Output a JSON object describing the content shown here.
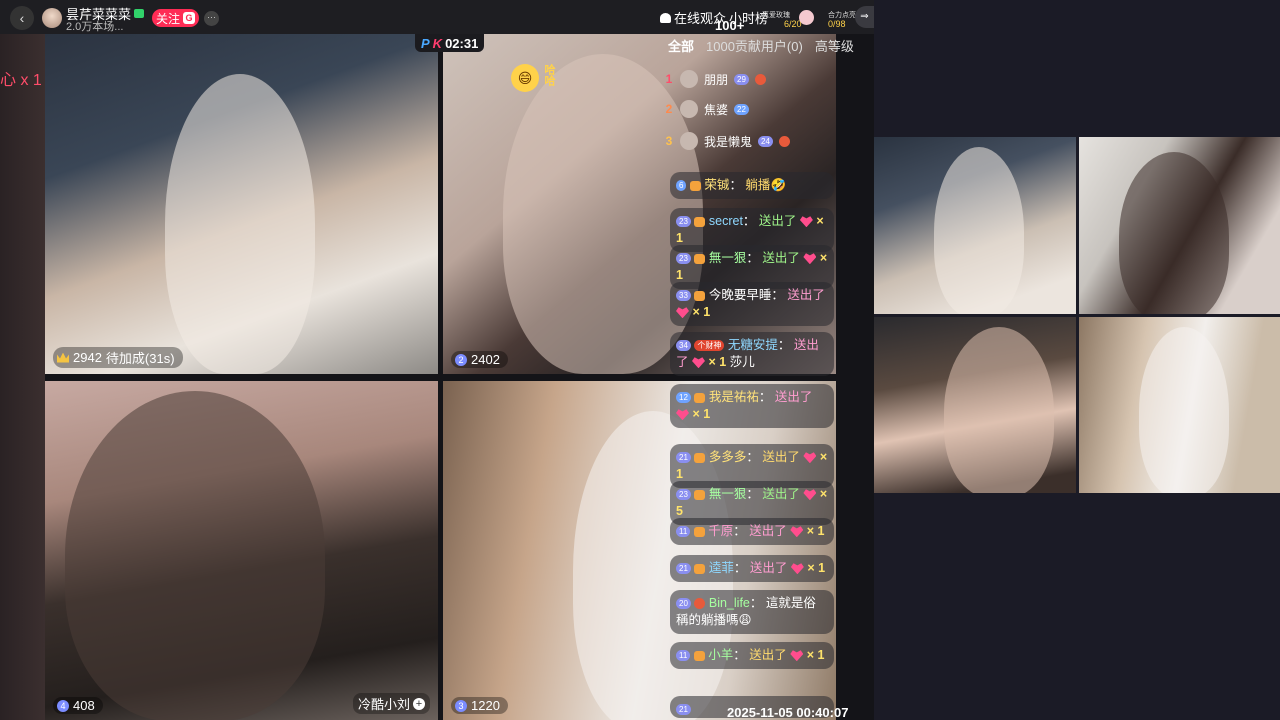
{
  "topbar": {
    "host_name": "昙芹菜菜菜",
    "host_sub": "2.0万本场...",
    "follow_label": "关注",
    "follow_icon": "G",
    "more_label": "···",
    "online_label": "在线观众",
    "online_count": "100+",
    "hourly_rank_label": "小时榜",
    "rose_label": "真爱玫瑰",
    "rose_value": "6/20",
    "combo_label": "合力点亮",
    "combo_value": "0/98",
    "side_toggle": "⇒"
  },
  "pk": {
    "p": "P",
    "k": "K",
    "timer": "02:31"
  },
  "float_gift": "心 x 1",
  "tiles": [
    {
      "score": "2942",
      "status": "待加成(31s)",
      "rank": ""
    },
    {
      "score": "2402",
      "rank": "2",
      "emoji": "😄",
      "emoji_text": "哈哈"
    },
    {
      "score": "408",
      "rank": "4",
      "name": "冷酷小刘"
    },
    {
      "score": "1220",
      "rank": "3"
    }
  ],
  "chat": {
    "tabs": [
      "全部",
      "1000贡献用户(0)",
      "高等级"
    ],
    "top_fans": [
      {
        "rank": "1",
        "name": "朋朋",
        "level": "29"
      },
      {
        "rank": "2",
        "name": "焦婆",
        "level": "22"
      },
      {
        "rank": "3",
        "name": "我是懒鬼",
        "level": "24"
      }
    ],
    "messages": [
      {
        "level": "6",
        "user": "荣铖",
        "action": "躺播",
        "emoji": "🤣",
        "times": ""
      },
      {
        "level": "23",
        "user": "secret",
        "action": "送出了",
        "times": "× 1"
      },
      {
        "level": "23",
        "user": "無一狠",
        "action": "送出了",
        "times": "× 1"
      },
      {
        "level": "33",
        "user": "今晚要早睡",
        "action": "送出了",
        "times": "× 1"
      },
      {
        "level": "34",
        "badge": "个财神",
        "user": "无糖安提",
        "action": "送出了",
        "times": "× 1",
        "tag_name": "莎儿"
      },
      {
        "level": "12",
        "user": "我是祐祐",
        "action": "送出了",
        "times": "× 1"
      },
      {
        "level": "21",
        "user": "多多多",
        "action": "送出了",
        "times": "× 1"
      },
      {
        "level": "23",
        "user": "無一狠",
        "action": "送出了",
        "times": "× 5"
      },
      {
        "level": "11",
        "user": "千原",
        "action": "送出了",
        "times": "× 1"
      },
      {
        "level": "21",
        "user": "逵菲",
        "action": "送出了",
        "times": "× 1"
      },
      {
        "level": "20",
        "user": "Bin_life",
        "action": "這就是俗稱的躺播嗎",
        "emoji": "😩",
        "times": ""
      },
      {
        "level": "11",
        "user": "小羊",
        "action": "送出了",
        "times": "× 1"
      },
      {
        "level": "21",
        "user": "",
        "action": "",
        "times": ""
      }
    ]
  },
  "timestamp": "2025-11-05 00:40:07"
}
